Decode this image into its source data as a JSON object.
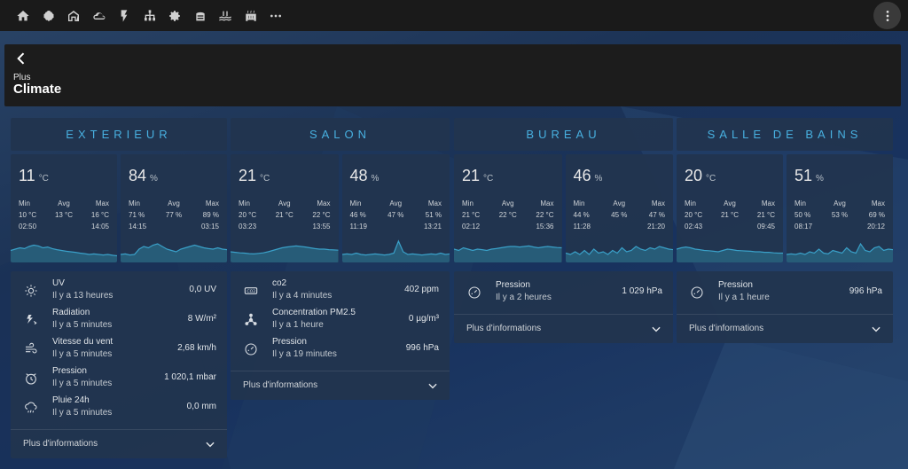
{
  "topbar": {
    "tabs": [
      "home-icon",
      "brain-icon",
      "house-icon",
      "cloud-icon",
      "flash-icon",
      "network-icon",
      "gear-icon",
      "vacuum-icon",
      "pool-icon",
      "radiator-icon",
      "more-horiz-icon"
    ],
    "menu_icon": "dots-vertical-icon"
  },
  "header": {
    "back_icon": "chevron-left-icon",
    "subtitle": "Plus",
    "title": "Climate"
  },
  "colors": {
    "accent": "#48b0e0",
    "card": "#22344e",
    "spark_fill": "#2a6a86",
    "spark_line": "#3aa0c8"
  },
  "columns": [
    {
      "title": "EXTERIEUR",
      "sensors": [
        {
          "value": "11",
          "unit": "°C",
          "min": "10 °C",
          "avg": "13 °C",
          "max": "16 °C",
          "min_time": "02:50",
          "max_time": "14:05",
          "trend": [
            0.45,
            0.5,
            0.55,
            0.52,
            0.6,
            0.65,
            0.62,
            0.55,
            0.58,
            0.52,
            0.48,
            0.45,
            0.42,
            0.4,
            0.38,
            0.35,
            0.33,
            0.3,
            0.32,
            0.3,
            0.28,
            0.3,
            0.27,
            0.25
          ]
        },
        {
          "value": "84",
          "unit": "%",
          "min": "71 %",
          "avg": "77 %",
          "max": "89 %",
          "min_time": "14:15",
          "max_time": "03:15",
          "trend": [
            0.3,
            0.32,
            0.28,
            0.3,
            0.5,
            0.6,
            0.55,
            0.65,
            0.7,
            0.6,
            0.5,
            0.45,
            0.4,
            0.5,
            0.55,
            0.6,
            0.65,
            0.6,
            0.55,
            0.52,
            0.5,
            0.55,
            0.5,
            0.48
          ]
        }
      ],
      "entities": [
        {
          "icon": "uv-icon",
          "name": "UV",
          "time": "Il y a 13 heures",
          "value": "0,0 UV"
        },
        {
          "icon": "radiation-icon",
          "name": "Radiation",
          "time": "Il y a 5 minutes",
          "value": "8 W/m²"
        },
        {
          "icon": "wind-icon",
          "name": "Vitesse du vent",
          "time": "Il y a 5 minutes",
          "value": "2,68 km/h"
        },
        {
          "icon": "gauge-icon",
          "name": "Pression",
          "time": "Il y a 5 minutes",
          "value": "1 020,1 mbar"
        },
        {
          "icon": "rain-icon",
          "name": "Pluie 24h",
          "time": "Il y a 5 minutes",
          "value": "0,0 mm"
        }
      ],
      "more": "Plus d'informations"
    },
    {
      "title": "SALON",
      "sensors": [
        {
          "value": "21",
          "unit": "°C",
          "min": "20 °C",
          "avg": "21 °C",
          "max": "22 °C",
          "min_time": "03:23",
          "max_time": "13:55",
          "trend": [
            0.4,
            0.38,
            0.36,
            0.35,
            0.33,
            0.32,
            0.34,
            0.36,
            0.4,
            0.45,
            0.5,
            0.55,
            0.58,
            0.6,
            0.62,
            0.6,
            0.58,
            0.55,
            0.52,
            0.5,
            0.5,
            0.48,
            0.47,
            0.46
          ]
        },
        {
          "value": "48",
          "unit": "%",
          "min": "46 %",
          "avg": "47 %",
          "max": "51 %",
          "min_time": "11:19",
          "max_time": "13:21",
          "trend": [
            0.3,
            0.32,
            0.3,
            0.35,
            0.3,
            0.28,
            0.3,
            0.32,
            0.3,
            0.28,
            0.3,
            0.35,
            0.8,
            0.4,
            0.3,
            0.32,
            0.3,
            0.28,
            0.3,
            0.32,
            0.3,
            0.35,
            0.3,
            0.32
          ]
        }
      ],
      "entities": [
        {
          "icon": "co2-icon",
          "name": "co2",
          "time": "Il y a 4 minutes",
          "value": "402 ppm"
        },
        {
          "icon": "molecule-icon",
          "name": "Concentration PM2.5",
          "time": "Il y a 1 heure",
          "value": "0 µg/m³"
        },
        {
          "icon": "gauge-icon",
          "name": "Pression",
          "time": "Il y a 19 minutes",
          "value": "996 hPa"
        }
      ],
      "more": "Plus d'informations"
    },
    {
      "title": "BUREAU",
      "sensors": [
        {
          "value": "21",
          "unit": "°C",
          "min": "21 °C",
          "avg": "22 °C",
          "max": "22 °C",
          "min_time": "02:12",
          "max_time": "15:36",
          "trend": [
            0.5,
            0.45,
            0.55,
            0.5,
            0.45,
            0.5,
            0.48,
            0.45,
            0.5,
            0.52,
            0.55,
            0.58,
            0.6,
            0.6,
            0.58,
            0.6,
            0.62,
            0.58,
            0.55,
            0.58,
            0.6,
            0.58,
            0.56,
            0.55
          ]
        },
        {
          "value": "46",
          "unit": "%",
          "min": "44 %",
          "avg": "45 %",
          "max": "47 %",
          "min_time": "11:28",
          "max_time": "21:20",
          "trend": [
            0.35,
            0.3,
            0.4,
            0.3,
            0.45,
            0.3,
            0.5,
            0.35,
            0.4,
            0.3,
            0.45,
            0.35,
            0.55,
            0.4,
            0.45,
            0.6,
            0.5,
            0.45,
            0.55,
            0.5,
            0.6,
            0.55,
            0.5,
            0.48
          ]
        }
      ],
      "entities": [
        {
          "icon": "gauge-icon",
          "name": "Pression",
          "time": "Il y a 2 heures",
          "value": "1 029 hPa"
        }
      ],
      "more": "Plus d'informations"
    },
    {
      "title": "SALLE DE BAINS",
      "sensors": [
        {
          "value": "20",
          "unit": "°C",
          "min": "20 °C",
          "avg": "21 °C",
          "max": "21 °C",
          "min_time": "02:43",
          "max_time": "09:45",
          "trend": [
            0.5,
            0.55,
            0.58,
            0.55,
            0.5,
            0.48,
            0.45,
            0.44,
            0.42,
            0.4,
            0.45,
            0.5,
            0.48,
            0.45,
            0.44,
            0.43,
            0.42,
            0.4,
            0.4,
            0.38,
            0.38,
            0.36,
            0.35,
            0.35
          ]
        },
        {
          "value": "51",
          "unit": "%",
          "min": "50 %",
          "avg": "53 %",
          "max": "69 %",
          "min_time": "08:17",
          "max_time": "20:12",
          "trend": [
            0.3,
            0.32,
            0.3,
            0.35,
            0.3,
            0.4,
            0.35,
            0.5,
            0.35,
            0.32,
            0.45,
            0.4,
            0.35,
            0.55,
            0.4,
            0.35,
            0.7,
            0.45,
            0.4,
            0.55,
            0.6,
            0.45,
            0.5,
            0.48
          ]
        }
      ],
      "entities": [
        {
          "icon": "gauge-icon",
          "name": "Pression",
          "time": "Il y a 1 heure",
          "value": "996 hPa"
        }
      ],
      "more": "Plus d'informations"
    }
  ]
}
